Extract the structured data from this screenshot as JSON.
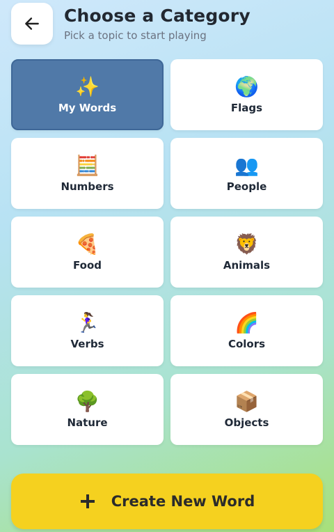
{
  "header": {
    "title": "Choose a Category",
    "subtitle": "Pick a topic to start playing"
  },
  "categories": [
    {
      "label": "My Words",
      "icon": "✨",
      "icon_name": "sparkles-icon",
      "selected": true
    },
    {
      "label": "Flags",
      "icon": "🌍",
      "icon_name": "globe-icon",
      "selected": false
    },
    {
      "label": "Numbers",
      "icon": "🧮",
      "icon_name": "abacus-icon",
      "selected": false
    },
    {
      "label": "People",
      "icon": "👥",
      "icon_name": "people-icon",
      "selected": false
    },
    {
      "label": "Food",
      "icon": "🍕",
      "icon_name": "pizza-icon",
      "selected": false
    },
    {
      "label": "Animals",
      "icon": "🦁",
      "icon_name": "lion-icon",
      "selected": false
    },
    {
      "label": "Verbs",
      "icon": "🏃‍♀️",
      "icon_name": "runner-icon",
      "selected": false
    },
    {
      "label": "Colors",
      "icon": "🌈",
      "icon_name": "rainbow-icon",
      "selected": false
    },
    {
      "label": "Nature",
      "icon": "🌳",
      "icon_name": "tree-icon",
      "selected": false
    },
    {
      "label": "Objects",
      "icon": "📦",
      "icon_name": "box-icon",
      "selected": false
    }
  ],
  "create_button": {
    "label": "Create New Word"
  },
  "colors": {
    "selected_card": "#5079a8",
    "create_button": "#f5d11f"
  }
}
